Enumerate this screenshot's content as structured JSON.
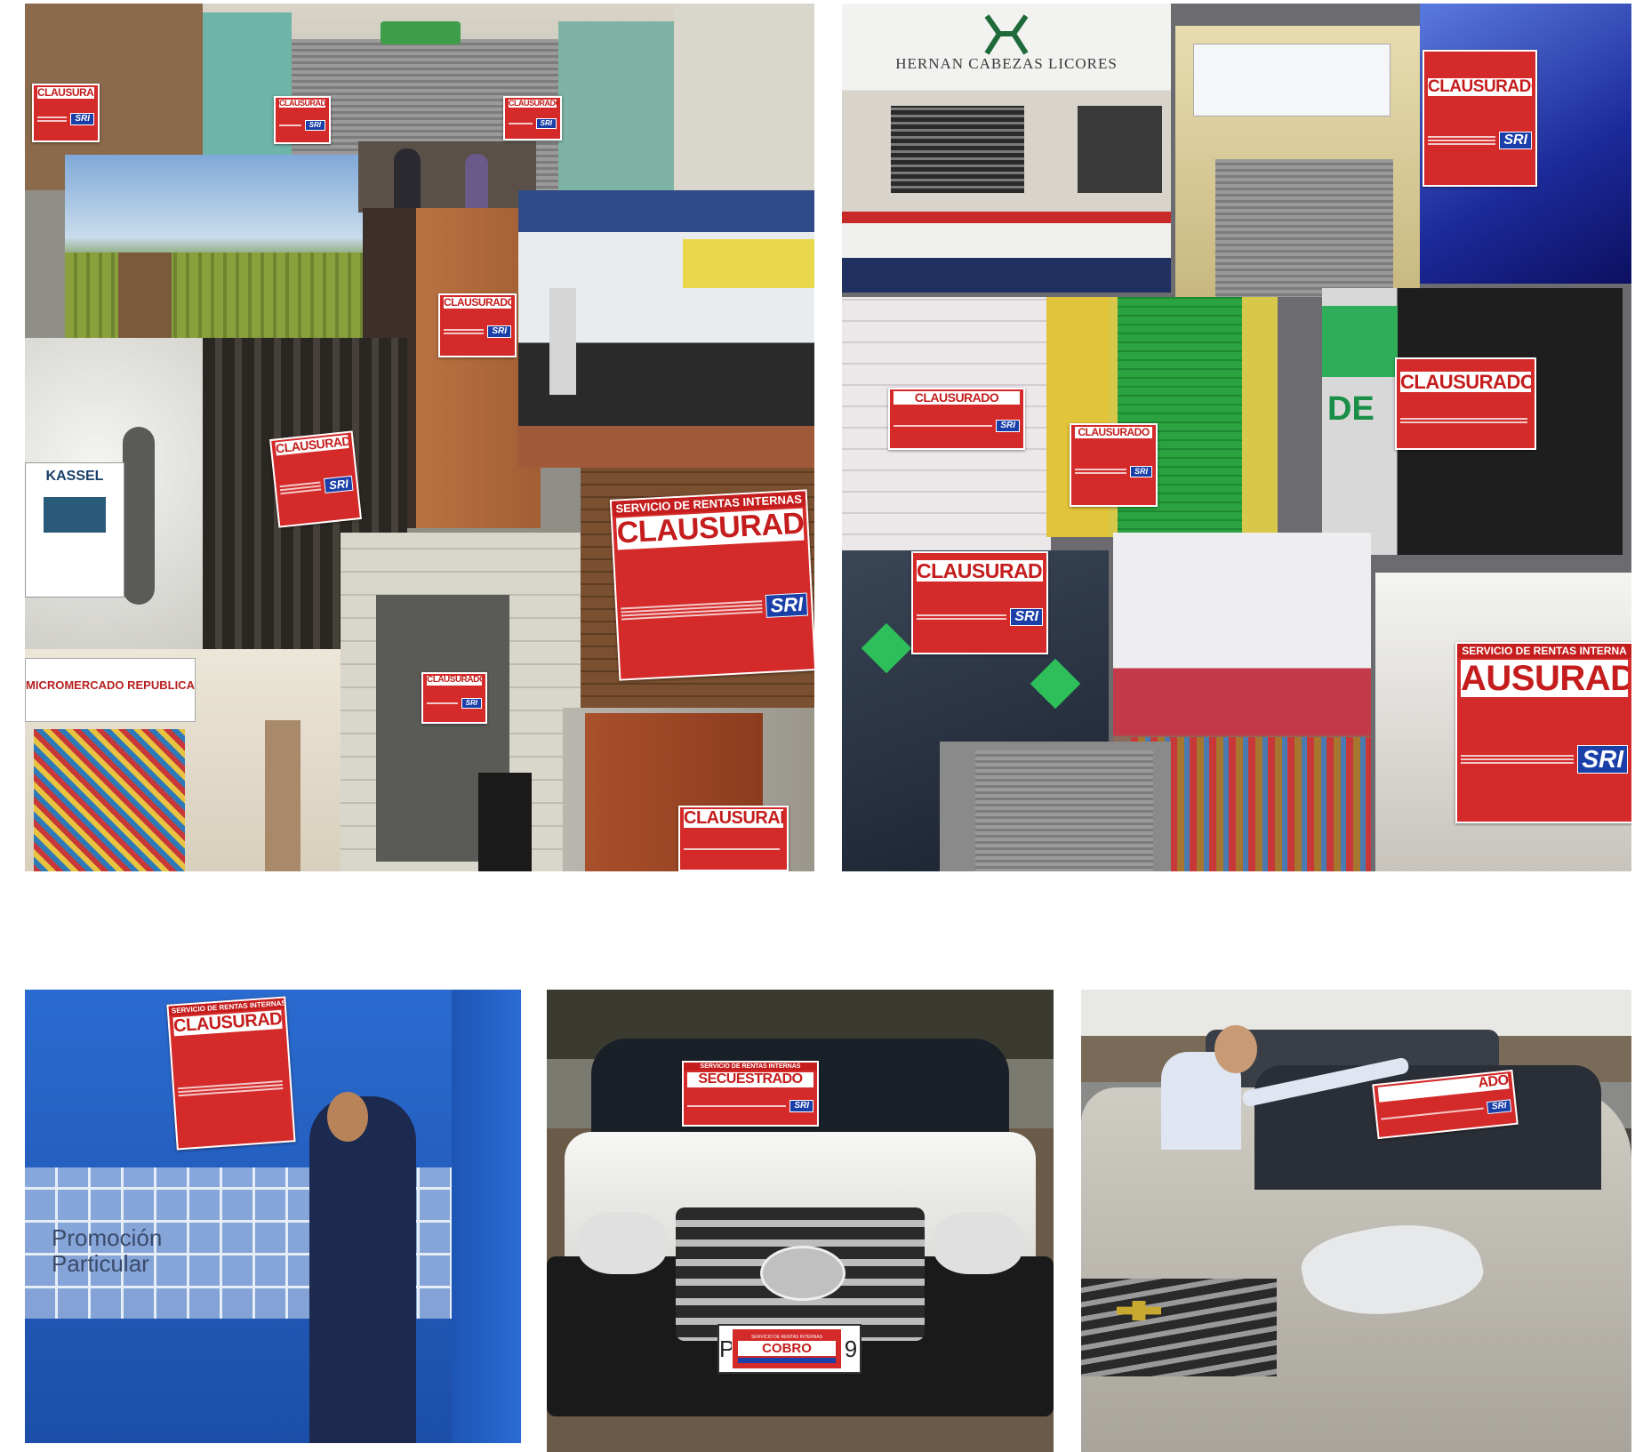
{
  "collage": {
    "top_left": {
      "signs": [
        "CLAUSURADO",
        "CLAUSURADO",
        "CLAUSURADO",
        "CLAUSURADO",
        "CLAUSURADO"
      ],
      "large_sign_header": "SERVICIO DE RENTAS INTERNAS",
      "large_sign_title": "CLAUSURADO",
      "store_banner": "MICROMERCADO REPUBLICA",
      "shop_name": "KASSEL"
    },
    "top_right": {
      "store_banner": "HERNAN CABEZAS LICORES",
      "signs": [
        "CLAUSURADO",
        "CLAUSURADO",
        "CLAUSURADO"
      ],
      "fragment_text": "DE",
      "large_sign_header": "SERVICIO DE RENTAS INTERNA",
      "large_sign_title": "AUSURADO"
    }
  },
  "photos": {
    "gate": {
      "sign_header": "SERVICIO DE RENTAS INTERNAS",
      "sign_title": "CLAUSURADO",
      "wall_text": "Promoción Particular"
    },
    "mazda": {
      "sign_header": "SERVICIO DE RENTAS INTERNAS",
      "sign_title": "SECUESTRADO",
      "plate_header": "SERVICIO DE RENTAS INTERNAS",
      "plate_title": "COBRO",
      "plate_left": "P",
      "plate_right": "9"
    },
    "chevrolet": {
      "sign_title": "ADO"
    }
  },
  "brand": {
    "logo_text": "SRI",
    "red": "#d42a2a",
    "blue": "#1a3fa8"
  }
}
